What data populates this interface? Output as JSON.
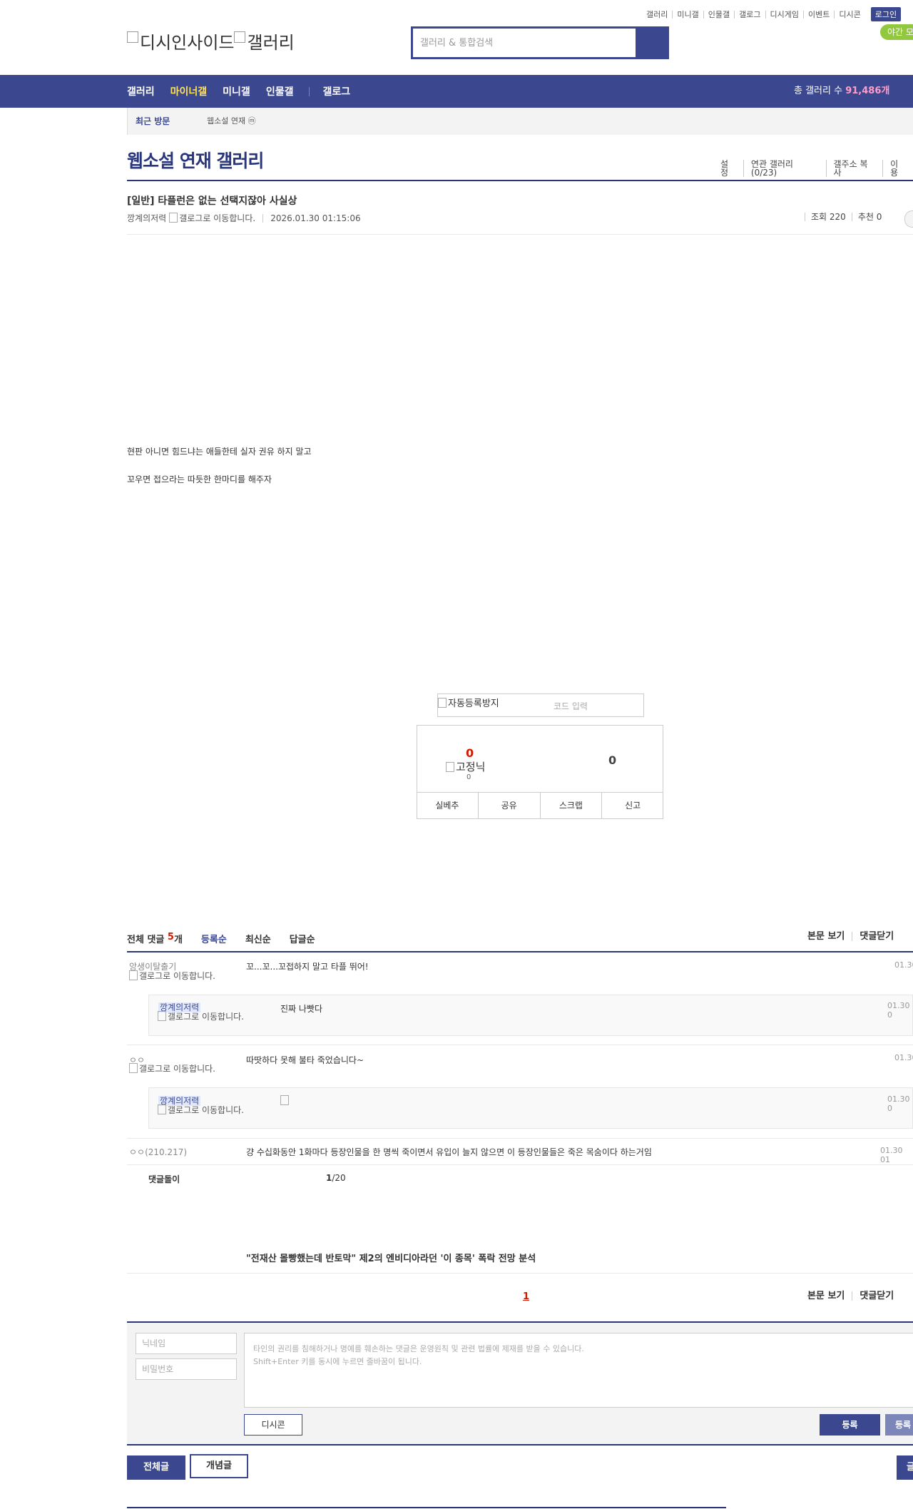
{
  "top_links": [
    "갤러리",
    "미니갤",
    "인물갤",
    "갤로그",
    "디시게임",
    "이벤트",
    "디시콘"
  ],
  "login_label": "로그인",
  "night_mode_label": "야간 모",
  "logo": {
    "alt1": "디시인사이드",
    "alt2": "갤러리"
  },
  "search": {
    "placeholder": "갤러리 & 통합검색"
  },
  "nav": {
    "items": [
      "갤러리",
      "마이너갤",
      "미니갤",
      "인물갤"
    ],
    "gallog": "갤로그",
    "count_label": "총 갤러리 수",
    "count_value": "91,486개"
  },
  "recent": {
    "label": "최근 방문",
    "item": "웹소설 연재 ⓜ"
  },
  "gallery": {
    "title": "웹소설 연재 갤러리",
    "tools": [
      "설정",
      "연관 갤러리(0/23)",
      "갤주소 복사",
      "이용"
    ]
  },
  "post": {
    "title": "[일반] 타플런은 없는 선택지잖아 사실상",
    "author": "깡계의저력",
    "gallog_alt": "갤로그로 이동합니다.",
    "date": "2026.01.30 01:15:06",
    "views": "조회 220",
    "recommend": "추천 0",
    "body": [
      "현판 아니면 힘드냐는 애들한테 실자 권유 하지 말고",
      "꼬우면 접으라는 따듯한 한마디를 해주자"
    ]
  },
  "captcha": {
    "img_alt": "자동등록방지",
    "placeholder": "코드 입력"
  },
  "recommend_box": {
    "up": "0",
    "fixed_nick": "고정닉",
    "fixed_count": "0",
    "down": "0",
    "actions": [
      "실베추",
      "공유",
      "스크랩",
      "신고"
    ]
  },
  "comments": {
    "total_label": "전체 댓글",
    "total_count": "5",
    "total_unit": "개",
    "sorts": [
      "등록순",
      "최신순",
      "답글순"
    ],
    "right_tools": [
      "본문 보기",
      "댓글닫기"
    ],
    "list": [
      {
        "nick": "앙생이탈출기",
        "text": "꼬...꼬...꼬접하지 말고 타플 뛰어!",
        "time": "01.30"
      },
      {
        "nick": "깡계의저력",
        "text": "진짜 나빳다",
        "time": "01.30 0",
        "reply": true
      },
      {
        "nick": "ㅇㅇ",
        "text": "따땃하다 못해 불타 죽었습니다~",
        "time": "01.30"
      },
      {
        "nick": "깡계의저력",
        "text": "",
        "time": "01.30 0",
        "reply": true
      },
      {
        "nick": "ㅇㅇ",
        "ip": "(210.217)",
        "text": "걍 수십화동안 1화마다 등장인물을 한 명씩 죽이면서 유입이 늘지 않으면 이 등장인물들은 죽은 목숨이다 하는거임",
        "time": "01.30 01"
      }
    ],
    "robot": "댓글돌이",
    "page_current": "1",
    "page_total": "/20"
  },
  "ad_headline": "\"전재산 몰빵했는데 반토막\" 제2의 엔비디아라던 '이 종목' 폭락 전망 분석",
  "page_number": "1",
  "write": {
    "nick_placeholder": "닉네임",
    "pw_placeholder": "비밀번호",
    "memo_placeholder": "타인의 권리를 침해하거나 명예를 훼손하는 댓글은 운영원칙 및 관련 법률에 제재를 받을 수 있습니다.\nShift+Enter 키를 동시에 누르면 줄바꿈이 됩니다.",
    "dccon": "디시콘",
    "submit": "등록",
    "submit_rec": "등록"
  },
  "bottom": {
    "all": "전체글",
    "concept": "개념글",
    "write": "글"
  },
  "colors": {
    "brand": "#3b4890",
    "accent": "#d31900",
    "nav_active": "#ffe259"
  }
}
